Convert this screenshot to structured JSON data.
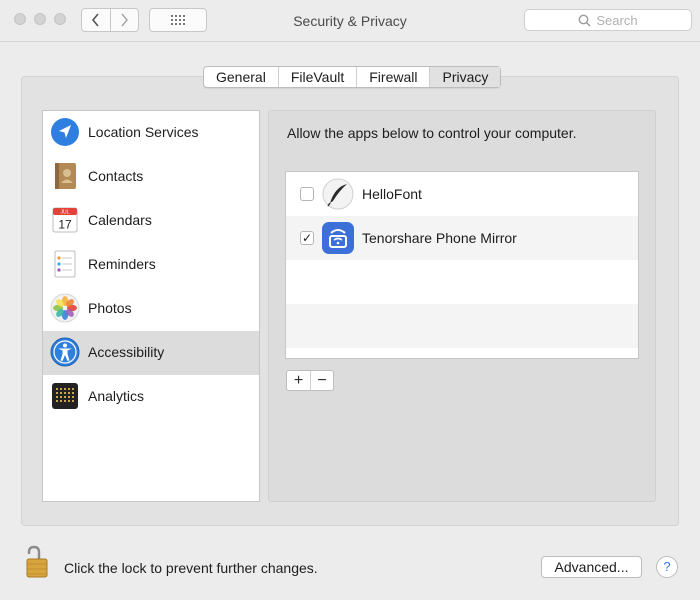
{
  "window": {
    "title": "Security & Privacy",
    "search_placeholder": "Search"
  },
  "tabs": [
    {
      "label": "General",
      "active": false
    },
    {
      "label": "FileVault",
      "active": false
    },
    {
      "label": "Firewall",
      "active": false
    },
    {
      "label": "Privacy",
      "active": true
    }
  ],
  "sidebar": {
    "items": [
      {
        "label": "Location Services",
        "icon": "location-arrow-icon",
        "selected": false
      },
      {
        "label": "Contacts",
        "icon": "contacts-book-icon",
        "selected": false
      },
      {
        "label": "Calendars",
        "icon": "calendar-icon",
        "selected": false,
        "icon_month": "JUL",
        "icon_day": "17"
      },
      {
        "label": "Reminders",
        "icon": "reminders-list-icon",
        "selected": false
      },
      {
        "label": "Photos",
        "icon": "photos-flower-icon",
        "selected": false
      },
      {
        "label": "Accessibility",
        "icon": "accessibility-figure-icon",
        "selected": true
      },
      {
        "label": "Analytics",
        "icon": "analytics-grid-icon",
        "selected": false
      }
    ]
  },
  "main": {
    "description": "Allow the apps below to control your computer.",
    "apps": [
      {
        "label": "HelloFont",
        "checked": false,
        "check_mark": "",
        "icon": "hellofont-quill-icon"
      },
      {
        "label": "Tenorshare Phone Mirror",
        "checked": true,
        "check_mark": "✓",
        "icon": "phone-mirror-icon"
      }
    ],
    "add_label": "+",
    "remove_label": "−"
  },
  "footer": {
    "lock_text": "Click the lock to prevent further changes.",
    "advanced_label": "Advanced...",
    "help_label": "?"
  },
  "colors": {
    "window_bg": "#ececec",
    "selected_row": "#dcdcdc",
    "accessibility_blue": "#2f7fe0",
    "phone_mirror_blue": "#3d6fd8"
  }
}
